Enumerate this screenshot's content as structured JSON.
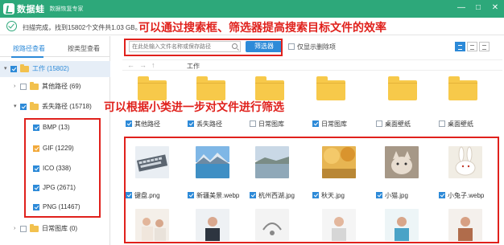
{
  "app": {
    "name": "数据蛙",
    "subtitle": "数据恢复专家",
    "window_controls": [
      "—",
      "□",
      "✕"
    ]
  },
  "status": {
    "text": "扫描完成，找到15802个文件共1.03 GB。"
  },
  "annotations": {
    "top": "可以通过搜索框、筛选器提高搜索目标文件的效率",
    "left": "可以根据小类进一步对文件进行筛选"
  },
  "tabs": [
    {
      "label": "按路径查看",
      "active": true
    },
    {
      "label": "按类型查看",
      "active": false
    }
  ],
  "tree": [
    {
      "label": "工作 (15802)",
      "level": 0,
      "checked": true,
      "expanded": true,
      "selected": true,
      "icon": "folder-icon"
    },
    {
      "label": "其他路径 (69)",
      "level": 1,
      "checked": false,
      "expanded": false,
      "icon": "folder-icon"
    },
    {
      "label": "丢失路径 (15718)",
      "level": 1,
      "checked": true,
      "expanded": true,
      "icon": "folder-icon"
    },
    {
      "label": "BMP (13)",
      "level": 2,
      "checked": true
    },
    {
      "label": "GIF (1229)",
      "level": 2,
      "checked": true
    },
    {
      "label": "ICO (338)",
      "level": 2,
      "checked": true
    },
    {
      "label": "JPG (2671)",
      "level": 2,
      "checked": true
    },
    {
      "label": "PNG (11467)",
      "level": 2,
      "checked": true
    },
    {
      "label": "日常图库 (0)",
      "level": 1,
      "checked": false,
      "expanded": false,
      "icon": "folder-icon"
    }
  ],
  "search": {
    "placeholder": "在此处输入文件名称或保存路径",
    "filter_label": "筛选器",
    "only_deleted_label": "仅显示删除项"
  },
  "breadcrumb": {
    "path": "工作"
  },
  "folders": [
    {
      "label": "其他路径",
      "checked": true
    },
    {
      "label": "丢失路径",
      "checked": true
    },
    {
      "label": "日常图库",
      "checked": false
    },
    {
      "label": "日常图库",
      "checked": true
    },
    {
      "label": "桌面壁纸",
      "checked": false
    },
    {
      "label": "桌面壁纸",
      "checked": false
    }
  ],
  "files": [
    {
      "label": "键盘.png",
      "checked": true,
      "icon": "keyboard-thumbnail"
    },
    {
      "label": "新疆美景.webp",
      "checked": true,
      "icon": "mountain-lake-thumbnail"
    },
    {
      "label": "杭州西湖.jpg",
      "checked": true,
      "icon": "west-lake-thumbnail"
    },
    {
      "label": "秋天.jpg",
      "checked": true,
      "icon": "autumn-thumbnail"
    },
    {
      "label": "小猫.jpg",
      "checked": true,
      "icon": "kitten-thumbnail"
    },
    {
      "label": "小兔子.webp",
      "checked": true,
      "icon": "rabbit-thumbnail"
    }
  ],
  "colors": {
    "brand": "#2da87a",
    "accent": "#2d8ad8",
    "annotation": "#e0211c",
    "folder": "#f7c94a"
  }
}
